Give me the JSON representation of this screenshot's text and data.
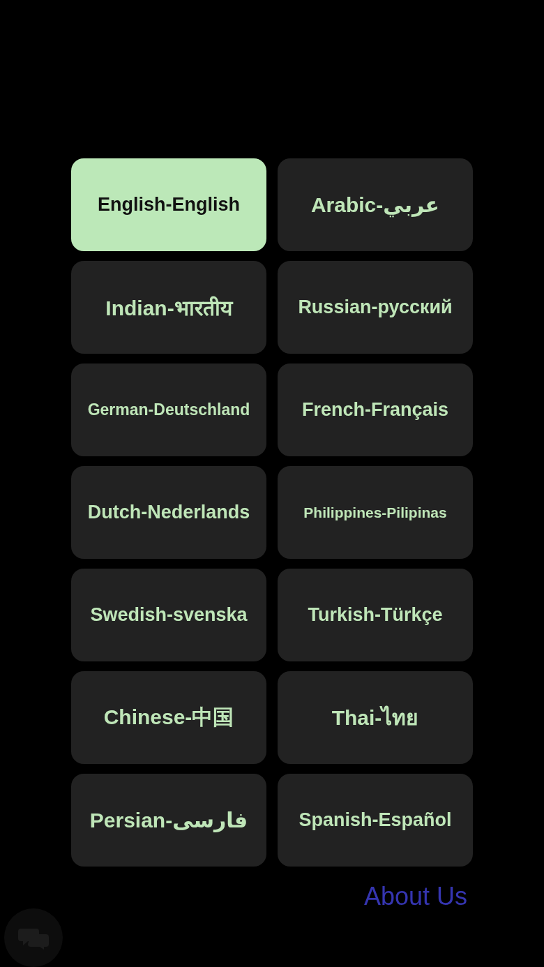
{
  "background_menu": [
    {
      "label": "About Us",
      "color": "#3535b0"
    }
  ],
  "language_dialog": {
    "languages": [
      {
        "label": "English-English",
        "selected": true
      },
      {
        "label": "Arabic-عربي",
        "selected": false
      },
      {
        "label": "Indian-भारतीय",
        "selected": false
      },
      {
        "label": "Russian-русский",
        "selected": false
      },
      {
        "label": "German-Deutschland",
        "selected": false
      },
      {
        "label": "French-Français",
        "selected": false
      },
      {
        "label": "Dutch-Nederlands",
        "selected": false
      },
      {
        "label": "Philippines-Pilipinas",
        "selected": false
      },
      {
        "label": "Swedish-svenska",
        "selected": false
      },
      {
        "label": "Turkish-Türkçe",
        "selected": false
      },
      {
        "label": "Chinese-中国",
        "selected": false
      },
      {
        "label": "Thai-ไทย",
        "selected": false
      },
      {
        "label": "Persian-فارسی",
        "selected": false
      },
      {
        "label": "Spanish-Español",
        "selected": false
      }
    ]
  }
}
